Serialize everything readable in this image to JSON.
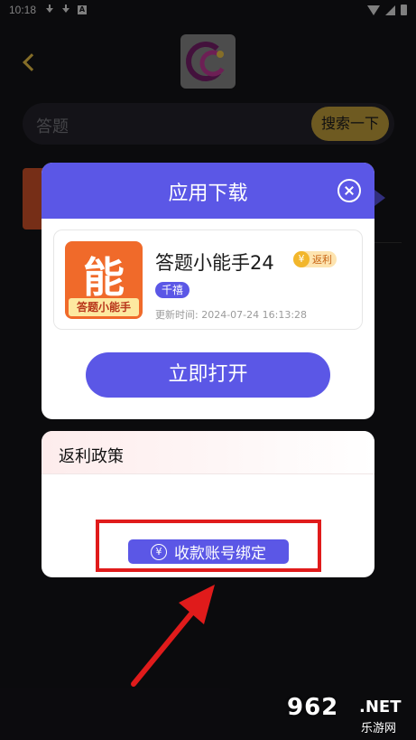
{
  "status_bar": {
    "time": "10:18",
    "badge": "A"
  },
  "search": {
    "placeholder": "答题",
    "button_label": "搜索一下"
  },
  "dialog": {
    "title": "应用下载",
    "app": {
      "icon_char": "能",
      "icon_tag": "答题小能手",
      "name": "答题小能手24",
      "rebate_badge": "返利",
      "rebate_icon": "¥",
      "tag": "千禧",
      "update_time": "更新时间: 2024-07-24 16:13:28"
    },
    "open_button": "立即打开"
  },
  "policy": {
    "title": "返利政策",
    "bind_button": "收款账号绑定",
    "bind_icon": "¥"
  },
  "watermark": {
    "number": "962",
    "suffix": ".NET",
    "site": "乐游网"
  },
  "colors": {
    "accent": "#5b57e6",
    "highlight": "#e01b1b",
    "search_button": "#c8a53c"
  }
}
